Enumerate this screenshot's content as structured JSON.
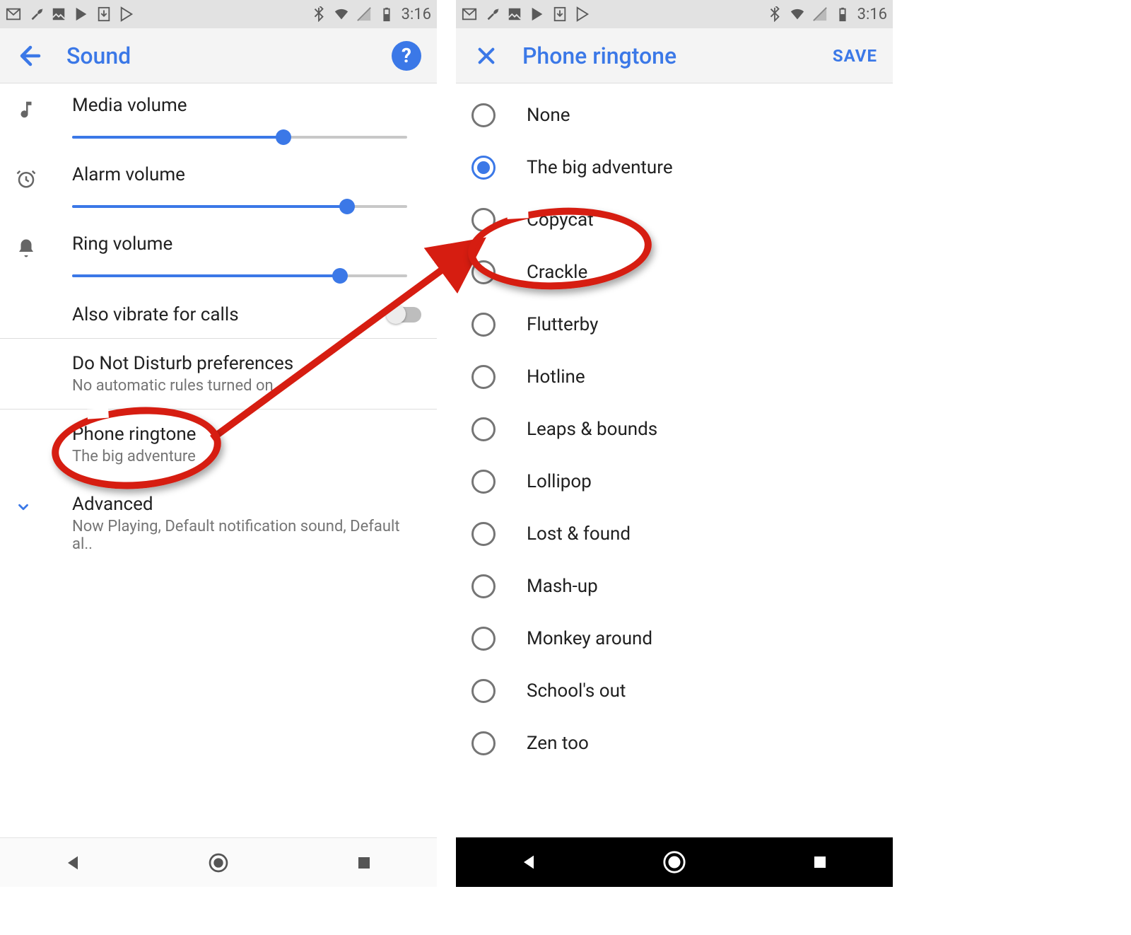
{
  "statusbar": {
    "time": "3:16"
  },
  "left_screen": {
    "title": "Sound",
    "sliders": {
      "media": {
        "label": "Media volume",
        "value": 63
      },
      "alarm": {
        "label": "Alarm volume",
        "value": 82
      },
      "ring": {
        "label": "Ring volume",
        "value": 80
      }
    },
    "vibrate": {
      "label": "Also vibrate for calls",
      "on": false
    },
    "dnd": {
      "title": "Do Not Disturb preferences",
      "sub": "No automatic rules turned on"
    },
    "ringtone": {
      "title": "Phone ringtone",
      "sub": "The big adventure"
    },
    "advanced": {
      "title": "Advanced",
      "sub": "Now Playing, Default notification sound, Default al.."
    }
  },
  "right_screen": {
    "title": "Phone ringtone",
    "save": "SAVE",
    "selected": 1,
    "items": [
      "None",
      "The big adventure",
      "Copycat",
      "Crackle",
      "Flutterby",
      "Hotline",
      "Leaps & bounds",
      "Lollipop",
      "Lost & found",
      "Mash-up",
      "Monkey around",
      "School's out",
      "Zen too"
    ]
  },
  "annotations": {
    "circle_left": {
      "id": "phone-ringtone-row"
    },
    "circle_right": {
      "id": "crackle-item"
    },
    "arrow": true
  }
}
